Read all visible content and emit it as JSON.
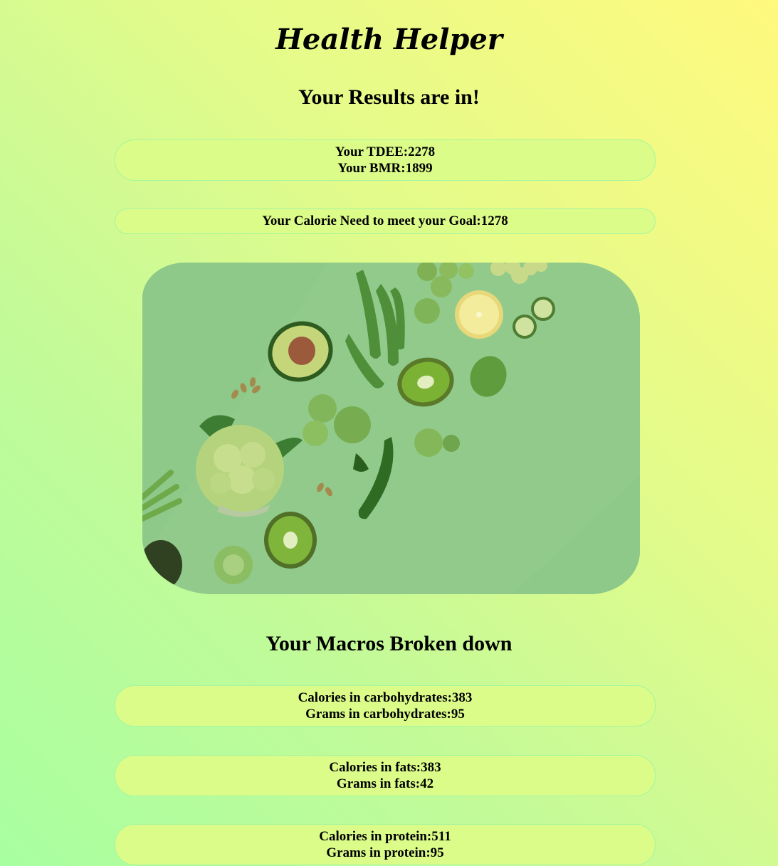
{
  "app": {
    "title": "Health Helper"
  },
  "results": {
    "heading": "Your Results are in!",
    "tdee_label": "Your TDEE:2278",
    "bmr_label": "Your BMR:1899",
    "goal_label": "Your Calorie Need to meet your Goal:1278"
  },
  "hero_image": {
    "subject": "green vegetables and fruits flat lay"
  },
  "macros": {
    "heading": "Your Macros Broken down",
    "carbs": {
      "calories_label": "Calories in carbohydrates:383",
      "grams_label": "Grams in carbohydrates:95"
    },
    "fats": {
      "calories_label": "Calories in fats:383",
      "grams_label": "Grams in fats:42"
    },
    "protein": {
      "calories_label": "Calories in protein:511",
      "grams_label": "Grams in protein:95"
    }
  },
  "colors": {
    "background_start": "#a8ffa0",
    "background_end": "#fff97e",
    "card_fill": "#dcfc8a",
    "card_border": "#a4f5a0",
    "photo_background": "#8cc987"
  }
}
